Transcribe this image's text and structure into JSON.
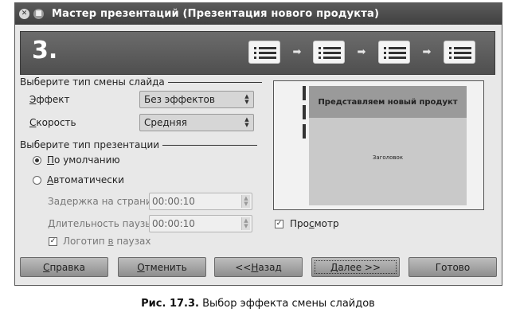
{
  "window": {
    "title": "Мастер презентаций (Презентация нового продукта)",
    "close_glyph": "✕",
    "menu_glyph": "■"
  },
  "banner": {
    "step": "3.",
    "arrow_glyph": "➡"
  },
  "transition": {
    "section_title": "Выберите тип смены слайда",
    "effect_label_u": "Э",
    "effect_label_rest": "ффект",
    "effect_value": "Без эффектов",
    "speed_label_u": "С",
    "speed_label_rest": "корость",
    "speed_value": "Средняя"
  },
  "presentation": {
    "section_title": "Выберите тип презентации",
    "default_u": "П",
    "default_rest": "о умолчанию",
    "auto_u": "А",
    "auto_rest": "втоматически",
    "delay_label": "Задержка на страни",
    "delay_value": "00:00:10",
    "pause_label": "Длительность паузы",
    "pause_value": "00:00:10",
    "logo_pre": "Логотип ",
    "logo_u": "в",
    "logo_post": " паузах",
    "selected": "default",
    "logo_checked": true
  },
  "preview": {
    "slide_title": "Представляем новый продукт",
    "slide_subtitle": "Заголовок",
    "checkbox_pre": "Про",
    "checkbox_u": "с",
    "checkbox_post": "мотр",
    "checkbox_checked": true
  },
  "buttons": {
    "help_u": "С",
    "help_rest": "правка",
    "cancel_u": "О",
    "cancel_rest": "тменить",
    "back_pre": "<< ",
    "back_u": "Н",
    "back_rest": "азад",
    "next_u": "Д",
    "next_rest": "алее >>",
    "done": "Готово"
  },
  "caption": {
    "bold": "Рис. 17.3.",
    "text": " Выбор эффекта смены слайдов"
  }
}
